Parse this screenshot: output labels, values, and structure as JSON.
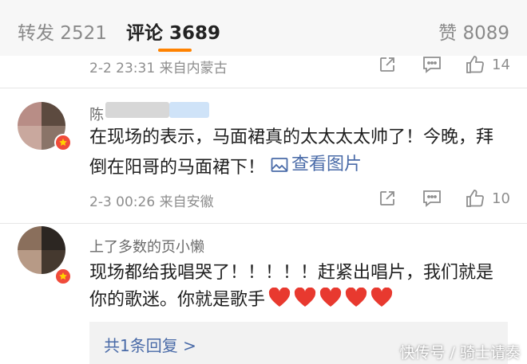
{
  "tabs": {
    "repost": "转发 2521",
    "comment": "评论 3689",
    "like": "赞 8089"
  },
  "comments": [
    {
      "time_location": "2-2 23:31 来自内蒙古",
      "like_count": "14"
    },
    {
      "username": "陈",
      "text": "在现场的表示，马面裙真的太太太太帅了！今晚，拜倒在阳哥的马面裙下！",
      "view_image": "查看图片",
      "time_location": "2-3 00:26 来自安徽",
      "like_count": "10"
    },
    {
      "username": "上了多数的页小懒_",
      "text": "现场都给我唱哭了！！！！！赶紧出唱片，我们就是你的歌迷。你就是歌手",
      "reply_summary": "共1条回复 >"
    }
  ],
  "watermark": "快传号 / 骑士请奏",
  "colors": {
    "accent": "#ff8200",
    "link": "#4a6ba8",
    "badge": "#f04b3a",
    "heart": "#e8392f"
  },
  "icons": [
    "share-icon",
    "comment-icon",
    "like-icon",
    "image-icon",
    "heart-emoji",
    "verified-badge-icon"
  ]
}
